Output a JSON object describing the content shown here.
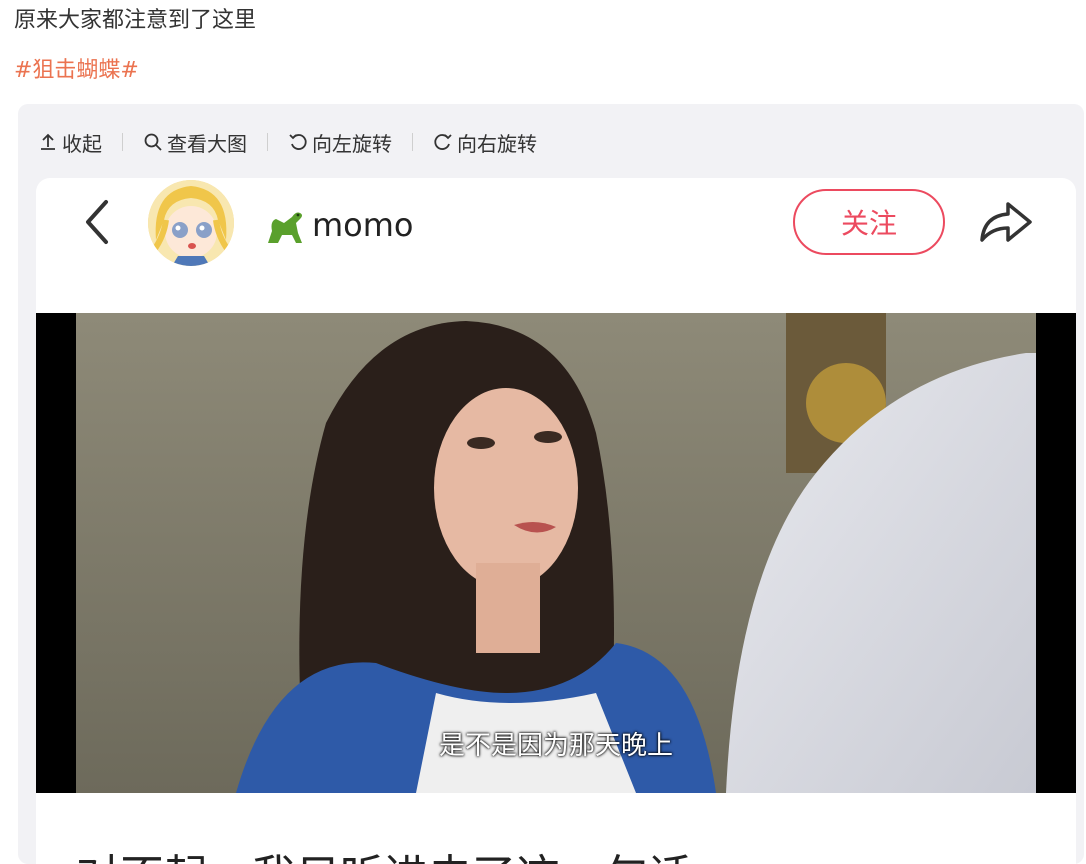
{
  "post": {
    "text": "原来大家都注意到了这里",
    "hashtag": "#狙击蝴蝶#"
  },
  "toolbar": {
    "collapse_label": "收起",
    "view_large_label": "查看大图",
    "rotate_left_label": "向左旋转",
    "rotate_right_label": "向右旋转"
  },
  "profile": {
    "username": "momo",
    "follow_label": "关注",
    "username_emoji_icon": "dinosaur-icon"
  },
  "video": {
    "subtitle": "是不是因为那天晚上"
  },
  "caption": {
    "text": "对不起，我只听进去了这一句话"
  },
  "colors": {
    "hashtag": "#eb7350",
    "follow_accent": "#ec4a5f"
  }
}
